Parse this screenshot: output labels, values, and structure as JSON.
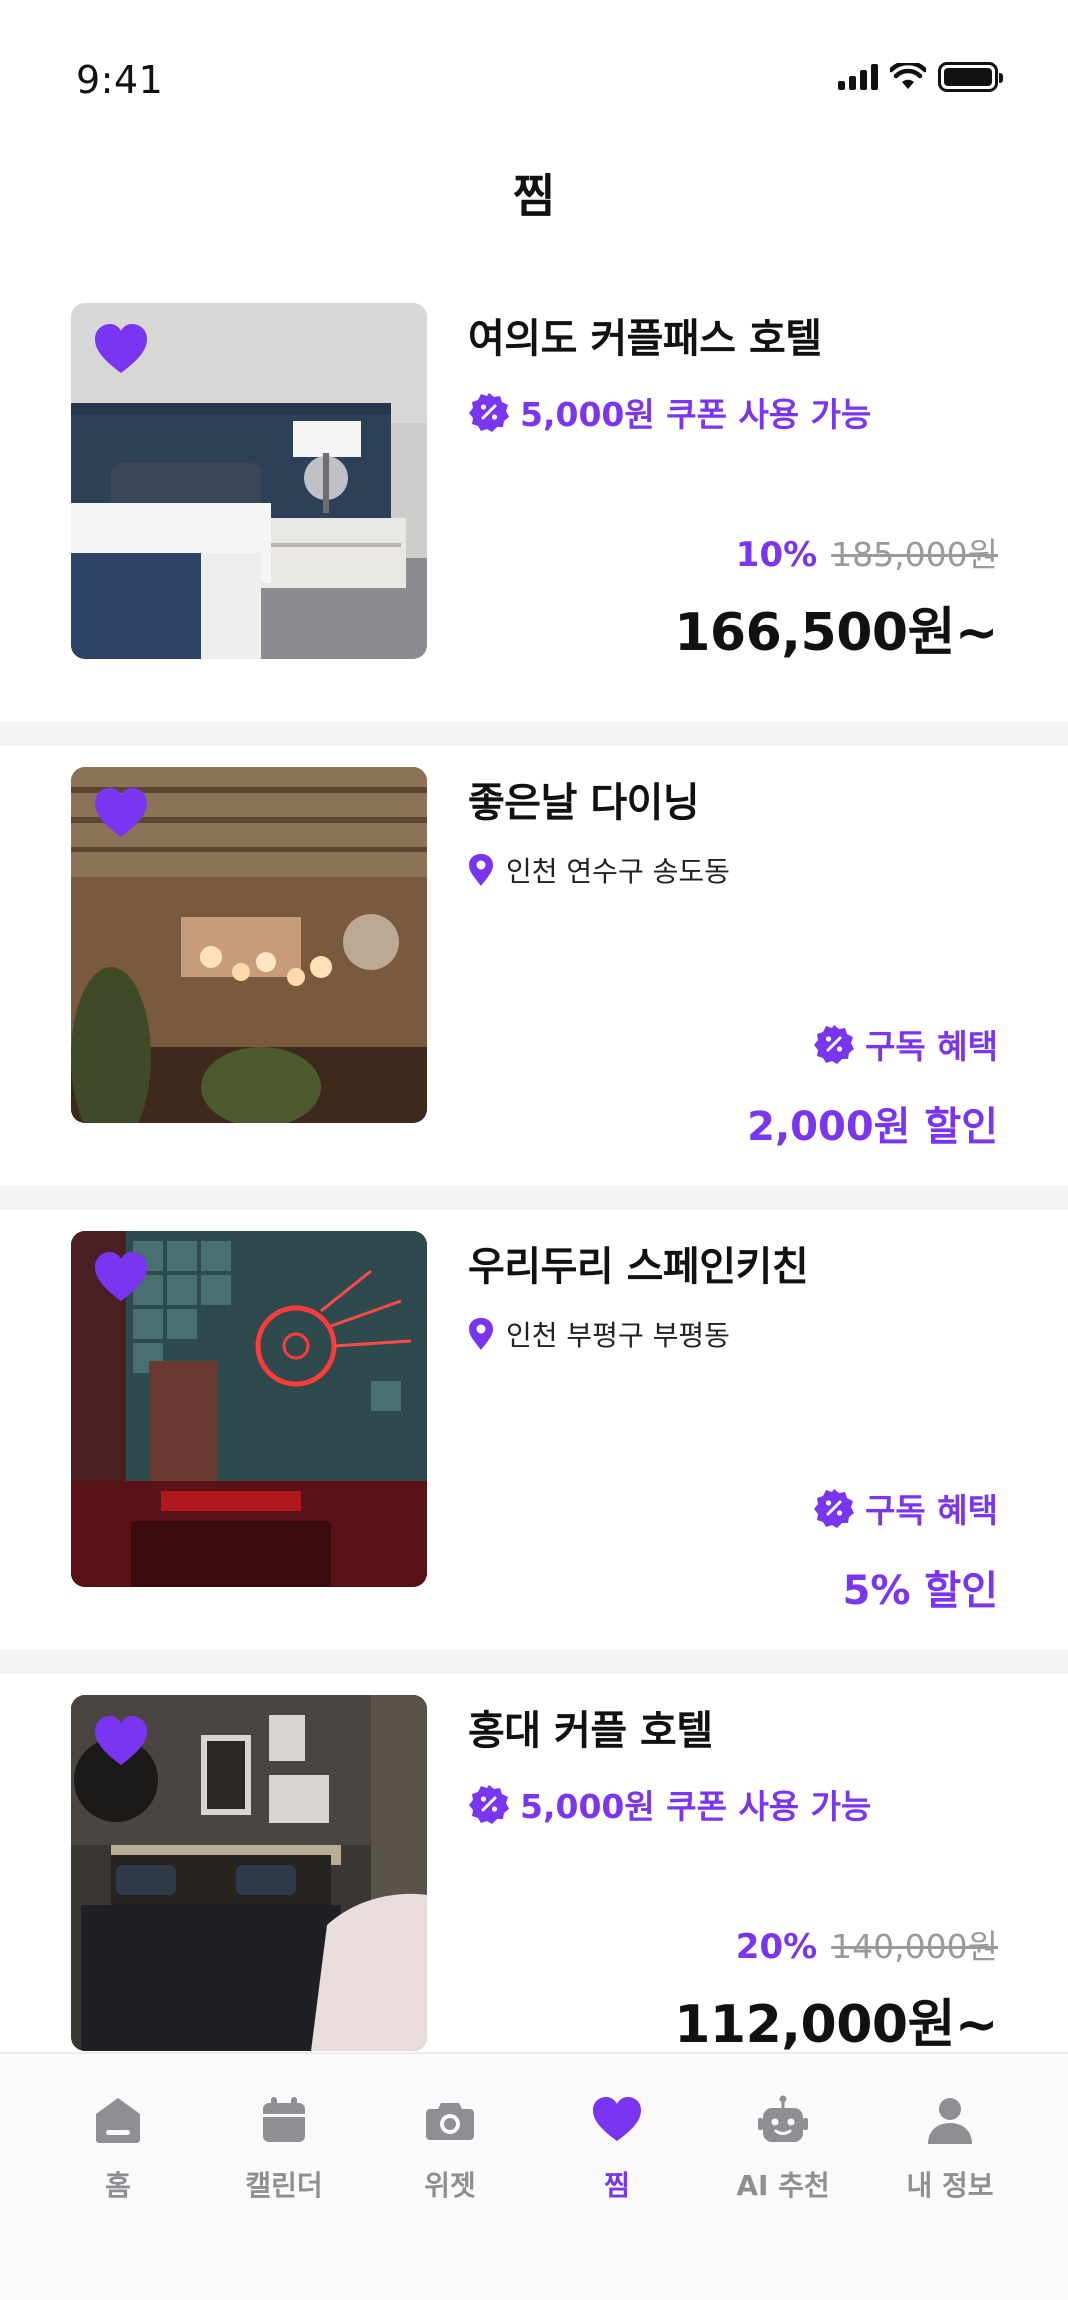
{
  "status": {
    "time": "9:41"
  },
  "page": {
    "title": "찜"
  },
  "colors": {
    "accent": "#7a35f0",
    "inactive": "#8e8e93",
    "separator": "#f2f3f5"
  },
  "items": [
    {
      "name": "여의도 커플패스 호텔",
      "coupon": "5,000원 쿠폰 사용 가능",
      "discount_rate": "10%",
      "original_price": "185,000원",
      "final_price": "166,500원~",
      "favorited": true,
      "image": "hotel-bedroom-photo"
    },
    {
      "name": "좋은날 다이닝",
      "location": "인천 연수구 송도동",
      "benefit_label": "구독 혜택",
      "benefit_value": "2,000원 할인",
      "favorited": true,
      "image": "restaurant-interior-photo"
    },
    {
      "name": "우리두리 스페인키친",
      "location": "인천 부평구 부평동",
      "benefit_label": "구독 혜택",
      "benefit_value": "5% 할인",
      "favorited": true,
      "image": "neon-restaurant-photo"
    },
    {
      "name": "홍대 커플 호텔",
      "coupon": "5,000원 쿠폰 사용 가능",
      "discount_rate": "20%",
      "original_price": "140,000원",
      "final_price": "112,000원~",
      "favorited": true,
      "image": "hotel-room-photo"
    }
  ],
  "tabs": [
    {
      "label": "홈",
      "icon": "home-icon",
      "active": false
    },
    {
      "label": "캘린더",
      "icon": "calendar-icon",
      "active": false
    },
    {
      "label": "위젯",
      "icon": "camera-icon",
      "active": false
    },
    {
      "label": "찜",
      "icon": "heart-icon",
      "active": true
    },
    {
      "label": "AI 추천",
      "icon": "robot-icon",
      "active": false
    },
    {
      "label": "내 정보",
      "icon": "person-icon",
      "active": false
    }
  ]
}
